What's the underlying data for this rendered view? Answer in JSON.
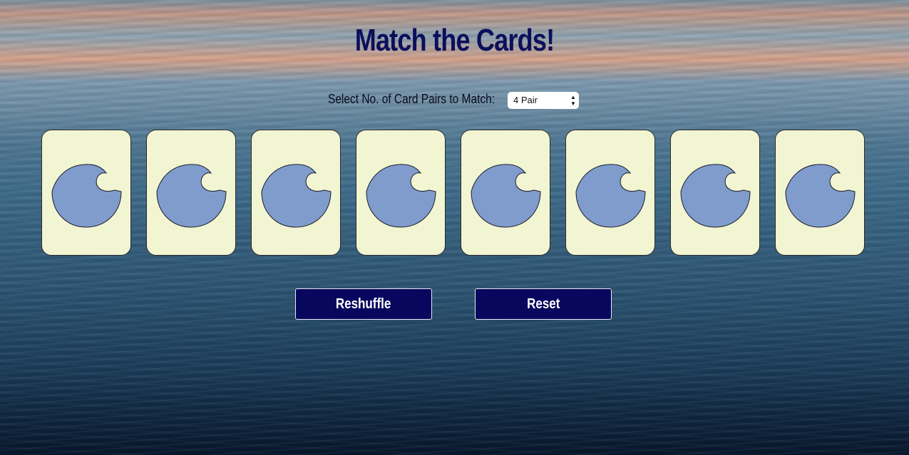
{
  "title": "Match the Cards!",
  "pair_select": {
    "label": "Select No. of Card Pairs to Match:",
    "selected": "4 Pair"
  },
  "cards": [
    {
      "face": "down",
      "back_icon": "wave-icon"
    },
    {
      "face": "down",
      "back_icon": "wave-icon"
    },
    {
      "face": "down",
      "back_icon": "wave-icon"
    },
    {
      "face": "down",
      "back_icon": "wave-icon"
    },
    {
      "face": "down",
      "back_icon": "wave-icon"
    },
    {
      "face": "down",
      "back_icon": "wave-icon"
    },
    {
      "face": "down",
      "back_icon": "wave-icon"
    },
    {
      "face": "down",
      "back_icon": "wave-icon"
    }
  ],
  "buttons": {
    "reshuffle": "Reshuffle",
    "reset": "Reset"
  },
  "colors": {
    "title": "#0b0f5c",
    "card_back": "#f2f5d2",
    "wave": "#7f9ccc",
    "button": "#08075e"
  }
}
